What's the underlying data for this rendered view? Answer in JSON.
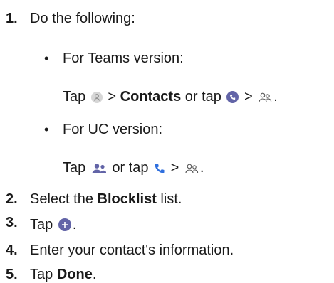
{
  "steps": [
    {
      "number": "1.",
      "text": "Do the following:"
    },
    {
      "number": "2.",
      "pre": "Select the ",
      "bold": "Blocklist",
      "post": " list."
    },
    {
      "number": "3.",
      "pre": "Tap ",
      "post": "."
    },
    {
      "number": "4.",
      "text": "Enter your contact's information."
    },
    {
      "number": "5.",
      "pre": "Tap ",
      "bold": "Done",
      "post": "."
    }
  ],
  "sub": {
    "teams": {
      "label": "For Teams version:",
      "tap": "Tap",
      "gt1": ">",
      "contacts": "Contacts",
      "or_tap": "or tap",
      "gt2": ">",
      "end": "."
    },
    "uc": {
      "label": "For UC version:",
      "tap": "Tap",
      "or_tap": "or tap",
      "gt": ">",
      "end": "."
    }
  },
  "bullet_char": "•",
  "icons": {
    "avatar": "avatar-icon",
    "phone_circle": "phone-circle-icon",
    "people_outline": "people-outline-icon",
    "people_filled": "people-filled-icon",
    "phone": "phone-icon",
    "add_circle": "add-circle-icon"
  },
  "colors": {
    "text": "#1a1a1a",
    "accent_purple": "#6264a7",
    "accent_blue": "#2f6fde",
    "icon_grey": "#c8c8c8"
  }
}
